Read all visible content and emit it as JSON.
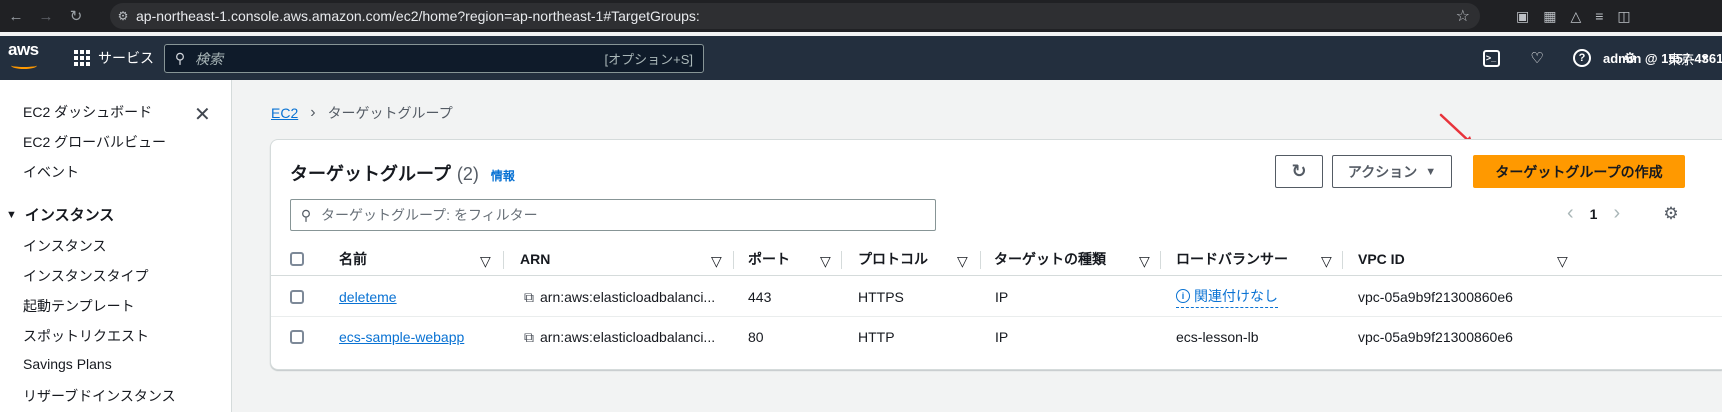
{
  "browser": {
    "url": "ap-northeast-1.console.aws.amazon.com/ec2/home?region=ap-northeast-1#TargetGroups:"
  },
  "header": {
    "logo_text": "aws",
    "services_label": "サービス",
    "search_placeholder": "検索",
    "search_shortcut": "[オプション+S]",
    "region": "東京",
    "account": "admin @ 1557-4361-"
  },
  "sidebar": {
    "items": [
      "EC2 ダッシュボード",
      "EC2 グローバルビュー",
      "イベント"
    ],
    "section": "インスタンス",
    "section_items": [
      "インスタンス",
      "インスタンスタイプ",
      "起動テンプレート",
      "スポットリクエスト",
      "Savings Plans",
      "リザーブドインスタンス"
    ]
  },
  "breadcrumb": {
    "root": "EC2",
    "current": "ターゲットグループ"
  },
  "panel": {
    "title": "ターゲットグループ",
    "count": "(2)",
    "info": "情報",
    "action_label": "アクション",
    "create_label": "ターゲットグループの作成",
    "filter_placeholder": "ターゲットグループ: をフィルター",
    "page": "1"
  },
  "table": {
    "columns": [
      "名前",
      "ARN",
      "ポート",
      "プロトコル",
      "ターゲットの種類",
      "ロードバランサー",
      "VPC ID"
    ],
    "rows": [
      {
        "name": "deleteme",
        "arn": "arn:aws:elasticloadbalanci...",
        "port": "443",
        "protocol": "HTTPS",
        "target_type": "IP",
        "load_balancer": "関連付けなし",
        "vpc_id": "vpc-05a9b9f21300860e6"
      },
      {
        "name": "ecs-sample-webapp",
        "arn": "arn:aws:elasticloadbalanci...",
        "port": "80",
        "protocol": "HTTP",
        "target_type": "IP",
        "load_balancer": "ecs-lesson-lb",
        "vpc_id": "vpc-05a9b9f21300860e6"
      }
    ]
  },
  "colors": {
    "primary_button": "#ff9900",
    "link": "#0972d3",
    "header_bg": "#232f3e",
    "annotation_arrow": "#e8333b"
  }
}
